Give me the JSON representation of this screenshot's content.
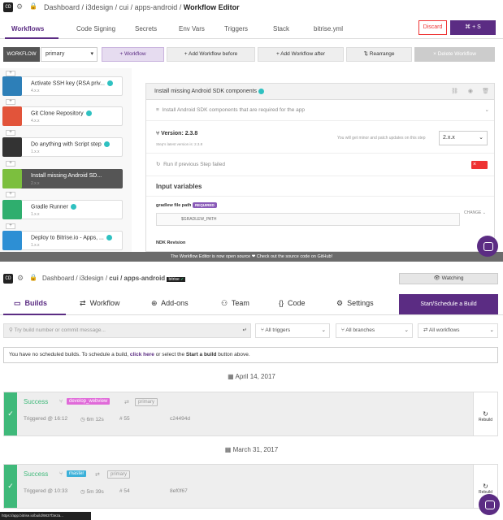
{
  "editor": {
    "breadcrumb": {
      "dashboard": "Dashboard",
      "org": "i3design",
      "path": "cui / apps-android",
      "sep": "/",
      "page": "Workflow Editor"
    },
    "tabs": [
      "Workflows",
      "Code Signing",
      "Secrets",
      "Env Vars",
      "Triggers",
      "Stack",
      "bitrise.yml"
    ],
    "discard": "Discard",
    "save": "⌘ + S",
    "workflow_label": "WORKFLOW",
    "workflow_value": "primary",
    "add_workflow": "+  Workflow",
    "add_before": "+  Add Workflow before",
    "add_after": "+  Add Workflow after",
    "rearrange": "⇅  Rearrange",
    "delete": "×  Delete Workflow",
    "steps": [
      {
        "name": "Activate SSH key (RSA priv...",
        "ver": "4.x.x",
        "color": "#2d7fb8"
      },
      {
        "name": "Git Clone Repository",
        "ver": "4.x.x",
        "color": "#e2543a"
      },
      {
        "name": "Do anything with Script step",
        "ver": "1.x.x",
        "color": "#333333"
      },
      {
        "name": "Install missing Android SD...",
        "ver": "2.x.x",
        "color": "#7cbf3e"
      },
      {
        "name": "Gradle Runner",
        "ver": "1.x.x",
        "color": "#2fae6e"
      },
      {
        "name": "Deploy to Bitrise.io - Apps, ...",
        "ver": "1.x.x",
        "color": "#2d8fd4"
      }
    ],
    "panel": {
      "title": "Install missing Android SDK components",
      "desc": "Install Android SDK components that are required for the app",
      "version_label": "Version: 2.3.8",
      "version_sub": "Step's latest version is: 2.3.8",
      "minor_note": "You will get minor and patch updates on this step",
      "version_select": "2.x.x",
      "run_if": "Run if previous Step failed",
      "inputs_title": "Input variables",
      "gradlew_label": "gradlew file path",
      "required": "REQUIRED",
      "gradlew_value": "$GRADLEW_PATH",
      "change": "CHANGE",
      "ndk": "NDK Revision"
    },
    "footer": "The Workflow Editor is now open source  ❤  Check out the source code on GitHub!"
  },
  "builds": {
    "breadcrumb": {
      "dashboard": "Dashboard",
      "org": "i3design",
      "path": "cui / apps-android",
      "badge": "bitrise"
    },
    "watching": "Watching",
    "tabs": [
      "Builds",
      "Workflow",
      "Add-ons",
      "Team",
      "Code",
      "Settings"
    ],
    "start": "Start/Schedule a Build",
    "search_placeholder": "Try build number or commit message...",
    "filter_triggers": "All triggers",
    "filter_branches": "All branches",
    "filter_workflows": "All workflows",
    "notice": {
      "pre": "You have no scheduled builds. To schedule a build, ",
      "link": "click here",
      "mid": " or select the ",
      "bold": "Start a build",
      "post": " button above."
    },
    "dates": [
      "April 14, 2017",
      "March 31, 2017"
    ],
    "items": [
      {
        "status": "Success",
        "branch": "develop_webview",
        "workflow": "primary",
        "triggered": "Triggered @ 16:12",
        "duration": "6m 12s",
        "num": "# 55",
        "commit": "c24494d",
        "rebuild": "Rebuild",
        "branch_bg": "#e06ad9"
      },
      {
        "status": "Success",
        "branch": "master",
        "workflow": "primary",
        "triggered": "Triggered @ 10:33",
        "duration": "5m 39s",
        "num": "# 54",
        "commit": "8ef0f67",
        "rebuild": "Rebuild",
        "branch_bg": "#3bb0d9"
      }
    ],
    "status_url": "https://app.bitrise.io/build/9837f3e2a..."
  }
}
